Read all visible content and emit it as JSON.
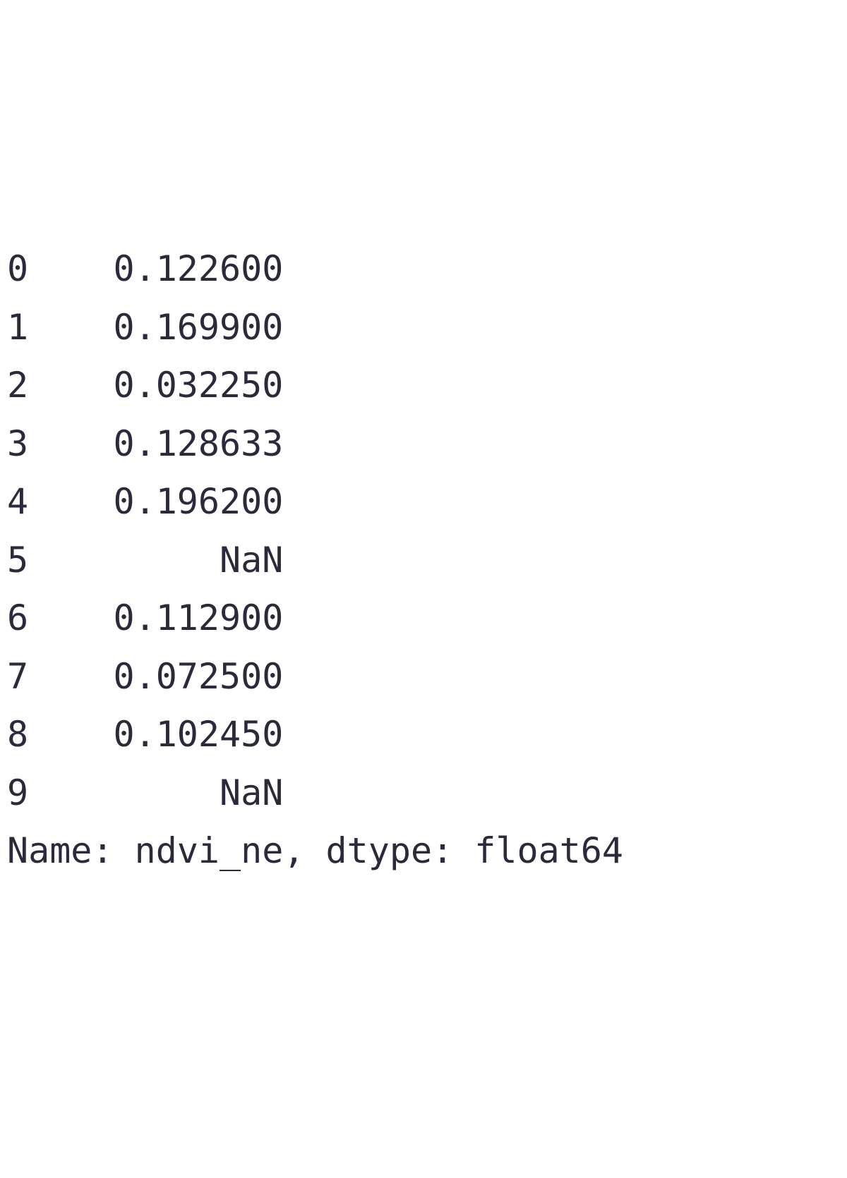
{
  "series": {
    "rows": [
      {
        "index": "0",
        "value": "0.122600"
      },
      {
        "index": "1",
        "value": "0.169900"
      },
      {
        "index": "2",
        "value": "0.032250"
      },
      {
        "index": "3",
        "value": "0.128633"
      },
      {
        "index": "4",
        "value": "0.196200"
      },
      {
        "index": "5",
        "value": "NaN"
      },
      {
        "index": "6",
        "value": "0.112900"
      },
      {
        "index": "7",
        "value": "0.072500"
      },
      {
        "index": "8",
        "value": "0.102450"
      },
      {
        "index": "9",
        "value": "NaN"
      }
    ],
    "footer": "Name: ndvi_ne, dtype: float64",
    "name": "ndvi_ne",
    "dtype": "float64"
  }
}
